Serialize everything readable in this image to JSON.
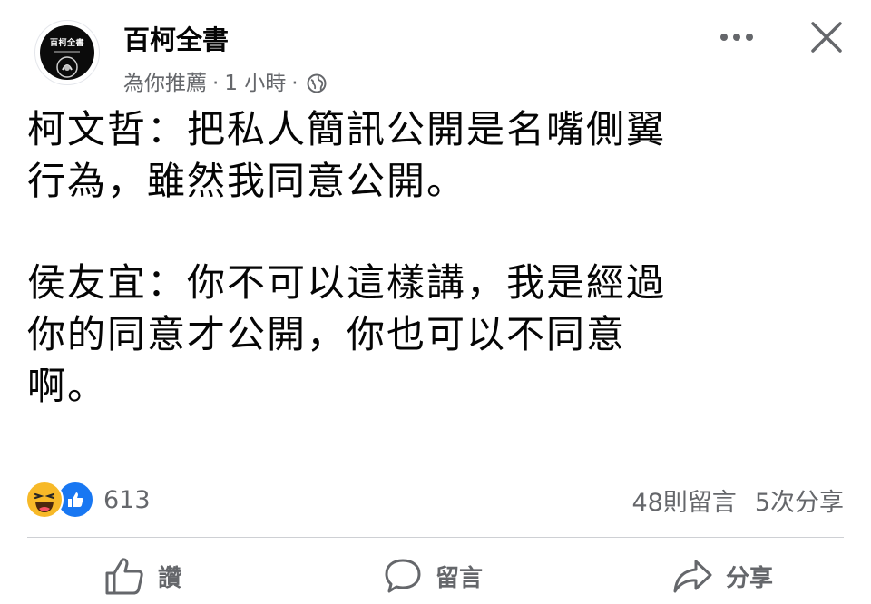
{
  "post": {
    "page_name": "百柯全書",
    "recommendation": "為你推薦",
    "time": "1 小時",
    "avatar_logo_text": "百柯全書",
    "paragraphs": [
      [
        "柯文哲：把私人簡訊公開是名嘴側翼",
        "行為，雖然我同意公開。"
      ],
      [
        "侯友宜：你不可以這樣講，我是經過",
        "你的同意才公開，你也可以不同意",
        "啊。"
      ]
    ]
  },
  "reactions": {
    "types": [
      "haha-icon",
      "like-icon"
    ],
    "count": "613"
  },
  "stats": {
    "comments": "48則留言",
    "shares": "5次分享"
  },
  "actions": {
    "like_label": "讚",
    "comment_label": "留言",
    "share_label": "分享"
  },
  "colors": {
    "text": "#050505",
    "secondary": "#65676b",
    "like_blue": "#1877f2",
    "haha_yellow": "#f7b928",
    "divider": "#ced0d4"
  }
}
